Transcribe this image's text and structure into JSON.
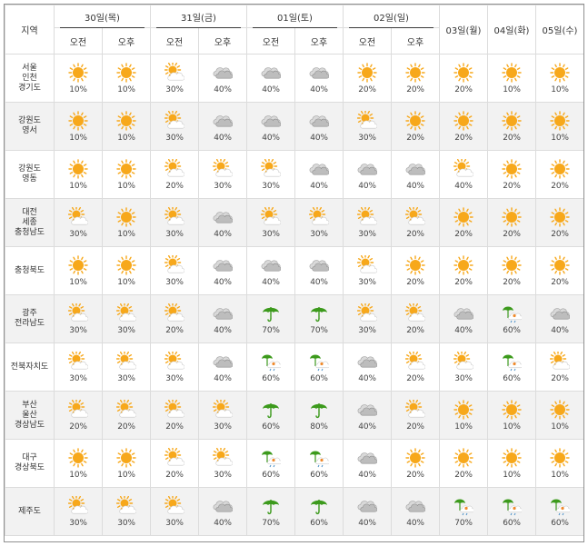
{
  "header": {
    "region_label": "지역",
    "days": [
      {
        "label": "30일(목)",
        "split": true
      },
      {
        "label": "31일(금)",
        "split": true
      },
      {
        "label": "01일(토)",
        "split": true
      },
      {
        "label": "02일(일)",
        "split": true
      },
      {
        "label": "03일(월)",
        "split": false
      },
      {
        "label": "04일(화)",
        "split": false
      },
      {
        "label": "05일(수)",
        "split": false
      }
    ],
    "am": "오전",
    "pm": "오후"
  },
  "rows": [
    {
      "region": [
        "서울",
        "인천",
        "경기도"
      ],
      "cells": [
        {
          "icon": "sun-icon",
          "pct": "10%"
        },
        {
          "icon": "sun-icon",
          "pct": "10%"
        },
        {
          "icon": "partly-cloudy-icon",
          "pct": "30%"
        },
        {
          "icon": "cloudy-icon",
          "pct": "40%"
        },
        {
          "icon": "cloudy-icon",
          "pct": "40%"
        },
        {
          "icon": "cloudy-icon",
          "pct": "40%"
        },
        {
          "icon": "sun-icon",
          "pct": "20%"
        },
        {
          "icon": "sun-icon",
          "pct": "20%"
        },
        {
          "icon": "sun-icon",
          "pct": "20%"
        },
        {
          "icon": "sun-icon",
          "pct": "10%"
        },
        {
          "icon": "sun-icon",
          "pct": "10%"
        }
      ]
    },
    {
      "region": [
        "강원도",
        "영서"
      ],
      "cells": [
        {
          "icon": "sun-icon",
          "pct": "10%"
        },
        {
          "icon": "sun-icon",
          "pct": "10%"
        },
        {
          "icon": "partly-cloudy-icon",
          "pct": "30%"
        },
        {
          "icon": "cloudy-icon",
          "pct": "40%"
        },
        {
          "icon": "cloudy-icon",
          "pct": "40%"
        },
        {
          "icon": "cloudy-icon",
          "pct": "40%"
        },
        {
          "icon": "partly-cloudy-icon",
          "pct": "30%"
        },
        {
          "icon": "sun-icon",
          "pct": "20%"
        },
        {
          "icon": "sun-icon",
          "pct": "20%"
        },
        {
          "icon": "sun-icon",
          "pct": "20%"
        },
        {
          "icon": "sun-icon",
          "pct": "10%"
        }
      ]
    },
    {
      "region": [
        "강원도",
        "영동"
      ],
      "cells": [
        {
          "icon": "sun-icon",
          "pct": "10%"
        },
        {
          "icon": "sun-icon",
          "pct": "10%"
        },
        {
          "icon": "partly-cloudy-icon",
          "pct": "20%"
        },
        {
          "icon": "partly-cloudy-icon",
          "pct": "30%"
        },
        {
          "icon": "partly-cloudy-icon",
          "pct": "30%"
        },
        {
          "icon": "cloudy-icon",
          "pct": "40%"
        },
        {
          "icon": "cloudy-icon",
          "pct": "40%"
        },
        {
          "icon": "cloudy-icon",
          "pct": "40%"
        },
        {
          "icon": "partly-cloudy-icon",
          "pct": "40%"
        },
        {
          "icon": "sun-icon",
          "pct": "20%"
        },
        {
          "icon": "sun-icon",
          "pct": "20%"
        }
      ]
    },
    {
      "region": [
        "대전",
        "세종",
        "충청남도"
      ],
      "cells": [
        {
          "icon": "partly-cloudy-icon",
          "pct": "30%"
        },
        {
          "icon": "sun-icon",
          "pct": "10%"
        },
        {
          "icon": "partly-cloudy-icon",
          "pct": "30%"
        },
        {
          "icon": "cloudy-icon",
          "pct": "40%"
        },
        {
          "icon": "partly-cloudy-icon",
          "pct": "30%"
        },
        {
          "icon": "partly-cloudy-icon",
          "pct": "30%"
        },
        {
          "icon": "partly-cloudy-icon",
          "pct": "30%"
        },
        {
          "icon": "partly-cloudy-icon",
          "pct": "20%"
        },
        {
          "icon": "sun-icon",
          "pct": "20%"
        },
        {
          "icon": "sun-icon",
          "pct": "20%"
        },
        {
          "icon": "sun-icon",
          "pct": "20%"
        }
      ]
    },
    {
      "region": [
        "충청북도"
      ],
      "cells": [
        {
          "icon": "sun-icon",
          "pct": "10%"
        },
        {
          "icon": "sun-icon",
          "pct": "10%"
        },
        {
          "icon": "partly-cloudy-icon",
          "pct": "30%"
        },
        {
          "icon": "cloudy-icon",
          "pct": "40%"
        },
        {
          "icon": "cloudy-icon",
          "pct": "40%"
        },
        {
          "icon": "cloudy-icon",
          "pct": "40%"
        },
        {
          "icon": "partly-cloudy-icon",
          "pct": "30%"
        },
        {
          "icon": "sun-icon",
          "pct": "20%"
        },
        {
          "icon": "sun-icon",
          "pct": "20%"
        },
        {
          "icon": "sun-icon",
          "pct": "20%"
        },
        {
          "icon": "sun-icon",
          "pct": "20%"
        }
      ]
    },
    {
      "region": [
        "광주",
        "전라남도"
      ],
      "cells": [
        {
          "icon": "partly-cloudy-icon",
          "pct": "30%"
        },
        {
          "icon": "partly-cloudy-icon",
          "pct": "30%"
        },
        {
          "icon": "partly-cloudy-icon",
          "pct": "20%"
        },
        {
          "icon": "cloudy-icon",
          "pct": "40%"
        },
        {
          "icon": "umbrella-icon",
          "pct": "70%"
        },
        {
          "icon": "umbrella-icon",
          "pct": "70%"
        },
        {
          "icon": "partly-cloudy-icon",
          "pct": "30%"
        },
        {
          "icon": "partly-cloudy-icon",
          "pct": "20%"
        },
        {
          "icon": "cloudy-icon",
          "pct": "40%"
        },
        {
          "icon": "rain-cloud-icon",
          "pct": "60%"
        },
        {
          "icon": "cloudy-icon",
          "pct": "40%"
        }
      ]
    },
    {
      "region": [
        "전북자치도"
      ],
      "cells": [
        {
          "icon": "partly-cloudy-icon",
          "pct": "30%"
        },
        {
          "icon": "partly-cloudy-icon",
          "pct": "30%"
        },
        {
          "icon": "partly-cloudy-icon",
          "pct": "30%"
        },
        {
          "icon": "cloudy-icon",
          "pct": "40%"
        },
        {
          "icon": "rain-cloud-icon",
          "pct": "60%"
        },
        {
          "icon": "rain-cloud-icon",
          "pct": "60%"
        },
        {
          "icon": "cloudy-icon",
          "pct": "40%"
        },
        {
          "icon": "partly-cloudy-icon",
          "pct": "20%"
        },
        {
          "icon": "partly-cloudy-icon",
          "pct": "30%"
        },
        {
          "icon": "rain-cloud-icon",
          "pct": "60%"
        },
        {
          "icon": "partly-cloudy-icon",
          "pct": "20%"
        }
      ]
    },
    {
      "region": [
        "부산",
        "울산",
        "경상남도"
      ],
      "cells": [
        {
          "icon": "partly-cloudy-icon",
          "pct": "20%"
        },
        {
          "icon": "partly-cloudy-icon",
          "pct": "20%"
        },
        {
          "icon": "partly-cloudy-icon",
          "pct": "20%"
        },
        {
          "icon": "partly-cloudy-icon",
          "pct": "30%"
        },
        {
          "icon": "umbrella-icon",
          "pct": "60%"
        },
        {
          "icon": "umbrella-icon",
          "pct": "80%"
        },
        {
          "icon": "cloudy-icon",
          "pct": "40%"
        },
        {
          "icon": "partly-cloudy-icon",
          "pct": "20%"
        },
        {
          "icon": "sun-icon",
          "pct": "10%"
        },
        {
          "icon": "sun-icon",
          "pct": "10%"
        },
        {
          "icon": "sun-icon",
          "pct": "10%"
        }
      ]
    },
    {
      "region": [
        "대구",
        "경상북도"
      ],
      "cells": [
        {
          "icon": "sun-icon",
          "pct": "10%"
        },
        {
          "icon": "sun-icon",
          "pct": "10%"
        },
        {
          "icon": "partly-cloudy-icon",
          "pct": "20%"
        },
        {
          "icon": "partly-cloudy-icon",
          "pct": "30%"
        },
        {
          "icon": "rain-cloud-icon",
          "pct": "60%"
        },
        {
          "icon": "rain-cloud-icon",
          "pct": "60%"
        },
        {
          "icon": "cloudy-icon",
          "pct": "40%"
        },
        {
          "icon": "sun-icon",
          "pct": "20%"
        },
        {
          "icon": "sun-icon",
          "pct": "20%"
        },
        {
          "icon": "sun-icon",
          "pct": "10%"
        },
        {
          "icon": "sun-icon",
          "pct": "10%"
        }
      ]
    },
    {
      "region": [
        "제주도"
      ],
      "cells": [
        {
          "icon": "partly-cloudy-icon",
          "pct": "30%"
        },
        {
          "icon": "partly-cloudy-icon",
          "pct": "30%"
        },
        {
          "icon": "partly-cloudy-icon",
          "pct": "30%"
        },
        {
          "icon": "cloudy-icon",
          "pct": "40%"
        },
        {
          "icon": "umbrella-icon",
          "pct": "70%"
        },
        {
          "icon": "umbrella-icon",
          "pct": "60%"
        },
        {
          "icon": "cloudy-icon",
          "pct": "40%"
        },
        {
          "icon": "cloudy-icon",
          "pct": "40%"
        },
        {
          "icon": "rain-cloud-icon",
          "pct": "70%"
        },
        {
          "icon": "rain-cloud-icon",
          "pct": "60%"
        },
        {
          "icon": "rain-cloud-icon",
          "pct": "60%"
        }
      ]
    }
  ],
  "colors": {
    "sun": "#f7a81b",
    "cloud": "#9a9a9a",
    "umbrella": "#3c9a1c",
    "rain": "#4a90c8",
    "border": "#dcdcdc",
    "stripe": "#f2f2f2"
  }
}
